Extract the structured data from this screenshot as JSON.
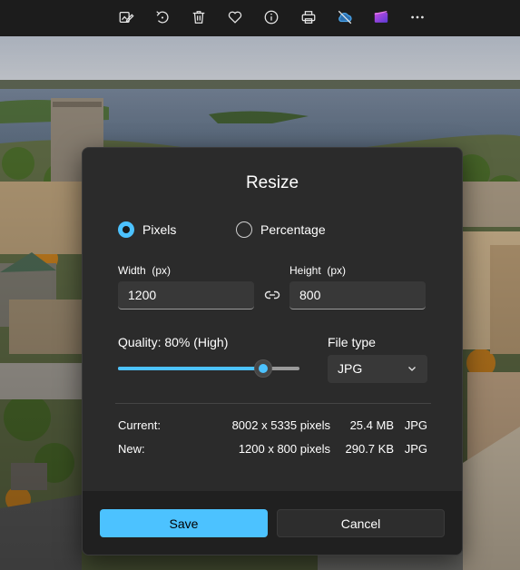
{
  "toolbar": {
    "icons": [
      "edit-image-icon",
      "rotate-icon",
      "delete-icon",
      "favorite-icon",
      "info-icon",
      "print-icon",
      "cloud-sync-off-icon",
      "clipchamp-icon",
      "more-icon"
    ]
  },
  "dialog": {
    "title": "Resize",
    "mode_options": {
      "pixels": "Pixels",
      "percentage": "Percentage",
      "selected": "pixels"
    },
    "width_label": "Width  (px)",
    "width_value": "1200",
    "height_label": "Height  (px)",
    "height_value": "800",
    "quality_label": "Quality: 80% (High)",
    "quality_percent": 80,
    "file_type_label": "File type",
    "file_type_value": "JPG",
    "current": {
      "label": "Current:",
      "dimensions": "8002 x 5335 pixels",
      "size": "25.4 MB",
      "type": "JPG"
    },
    "new": {
      "label": "New:",
      "dimensions": "1200 x 800 pixels",
      "size": "290.7 KB",
      "type": "JPG"
    },
    "save_label": "Save",
    "cancel_label": "Cancel"
  },
  "colors": {
    "accent": "#4cc2ff",
    "dialog_bg": "#2b2b2b",
    "footer_bg": "#202020"
  }
}
